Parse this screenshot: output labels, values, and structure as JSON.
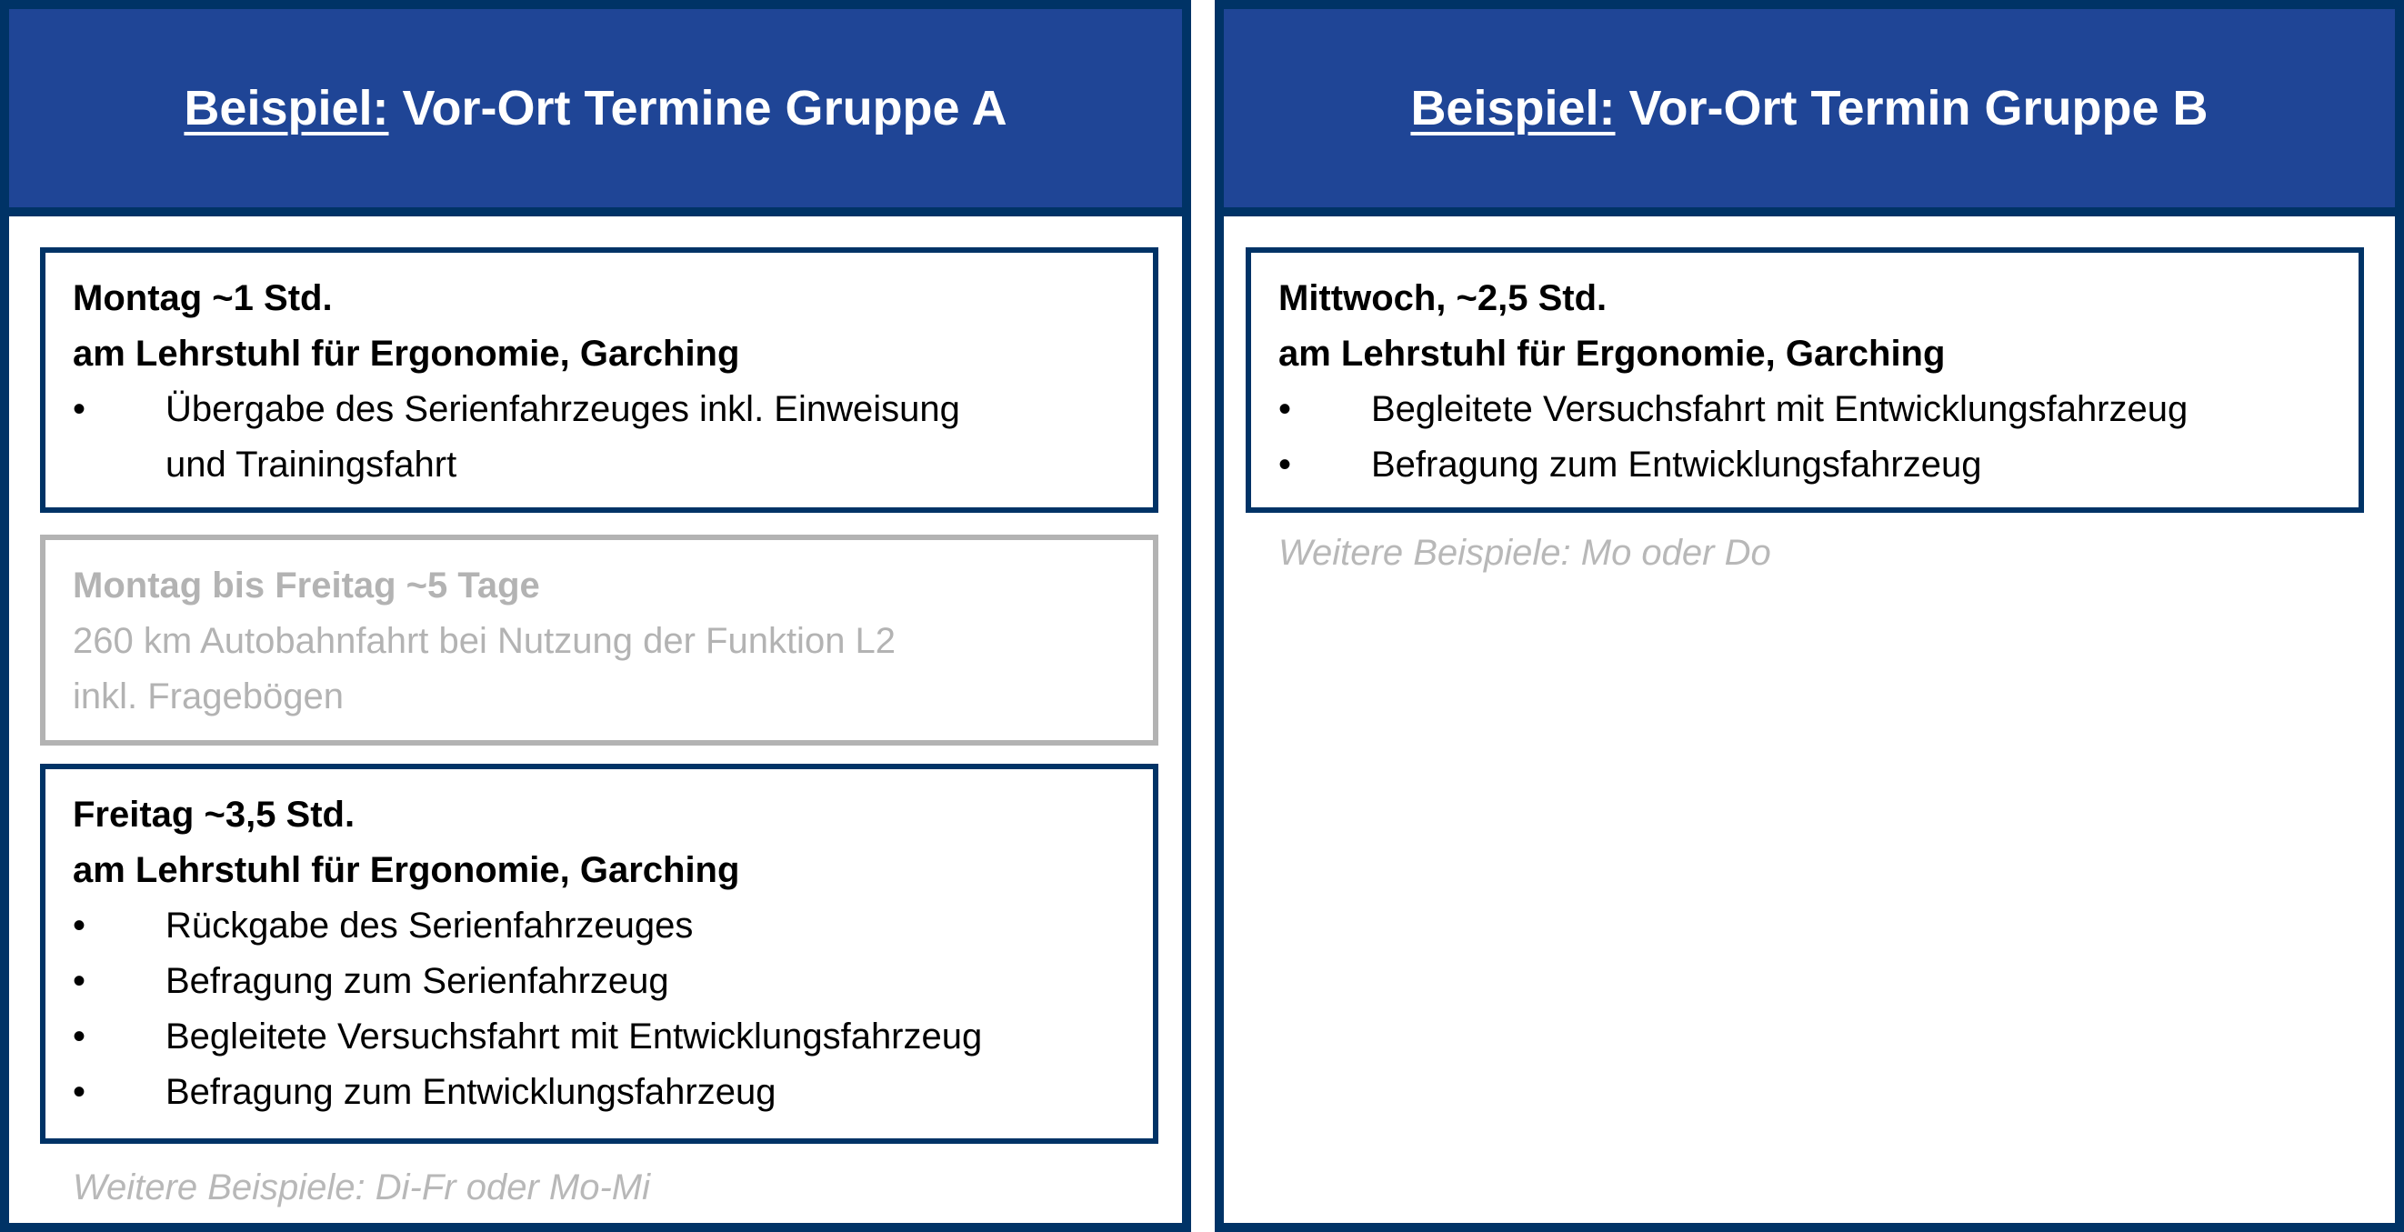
{
  "group_a": {
    "title_prefix": "Beispiel:",
    "title_rest": " Vor-Ort Termine Gruppe A",
    "box1": {
      "line1": "Montag ~1 Std.",
      "line2": "am Lehrstuhl für Ergonomie, Garching",
      "bullets": [
        "Übergabe des Serienfahrzeuges inkl. Einweisung",
        "und Trainingsfahrt"
      ]
    },
    "box2": {
      "line1": "Montag bis Freitag ~5 Tage",
      "line2": "260 km Autobahnfahrt bei Nutzung der Funktion L2",
      "line3": "inkl. Fragebögen"
    },
    "box3": {
      "line1": "Freitag ~3,5 Std.",
      "line2": "am Lehrstuhl für Ergonomie, Garching",
      "bullets": [
        "Rückgabe des Serienfahrzeuges",
        "Befragung zum Serienfahrzeug",
        "Begleitete Versuchsfahrt mit Entwicklungsfahrzeug",
        "Befragung zum Entwicklungsfahrzeug"
      ]
    },
    "note": "Weitere Beispiele: Di-Fr oder Mo-Mi"
  },
  "group_b": {
    "title_prefix": "Beispiel:",
    "title_rest": " Vor-Ort Termin Gruppe B",
    "box1": {
      "line1": "Mittwoch, ~2,5 Std.",
      "line2": "am Lehrstuhl für Ergonomie, Garching",
      "bullets": [
        "Begleitete Versuchsfahrt mit Entwicklungsfahrzeug",
        "Befragung zum Entwicklungsfahrzeug"
      ]
    },
    "note": "Weitere Beispiele: Mo oder Do"
  },
  "bullet_symbol": "•",
  "colors": {
    "header_fill": "#1f4596",
    "border": "#003366",
    "muted": "#b3b3b3"
  }
}
